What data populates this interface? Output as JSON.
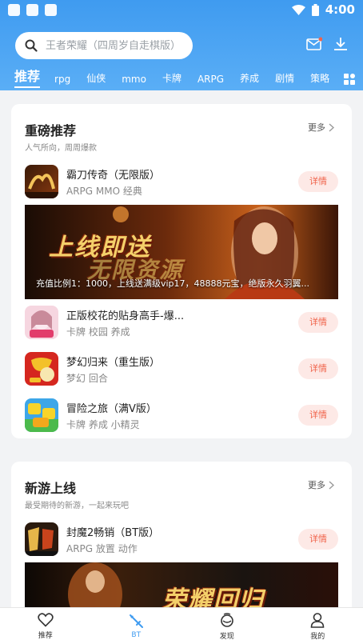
{
  "status": {
    "time": "4:00"
  },
  "header": {
    "search_placeholder": "王者荣耀（四周岁自走棋版）",
    "mail_icon": "mail-icon",
    "download_icon": "download-icon"
  },
  "categories": [
    "推荐",
    "rpg",
    "仙侠",
    "mmo",
    "卡牌",
    "ARPG",
    "养成",
    "剧情",
    "策略"
  ],
  "sections": [
    {
      "title": "重磅推荐",
      "subtitle": "人气所向，周周爆款",
      "more": "更多",
      "games": [
        {
          "name": "霸刀传奇（无限版）",
          "tags": "ARPG MMO 经典",
          "button": "详情"
        },
        {
          "name": "正版校花的贴身高手-爆...",
          "tags": "卡牌 校园 养成",
          "button": "详情"
        },
        {
          "name": "梦幻归来（重生版）",
          "tags": "梦幻 回合",
          "button": "详情"
        },
        {
          "name": "冒险之旅（满V版）",
          "tags": "卡牌 养成 小精灵",
          "button": "详情"
        }
      ],
      "banner": {
        "line1": "上线即送",
        "line2": "无限资源",
        "caption": "充值比例1：1000，上线送满级vip17，48888元宝，绝版永久羽翼..."
      }
    },
    {
      "title": "新游上线",
      "subtitle": "最受期待的新游，一起来玩吧",
      "more": "更多",
      "games": [
        {
          "name": "封魔2畅销（BT版）",
          "tags": "ARPG 放置 动作",
          "button": "详情"
        }
      ],
      "banner": {
        "line1": "荣耀回归"
      }
    }
  ],
  "tabbar": [
    "推荐",
    "BT",
    "发现",
    "我的"
  ],
  "colors": {
    "primary": "#3f9bf0",
    "accent": "#f0634a"
  }
}
